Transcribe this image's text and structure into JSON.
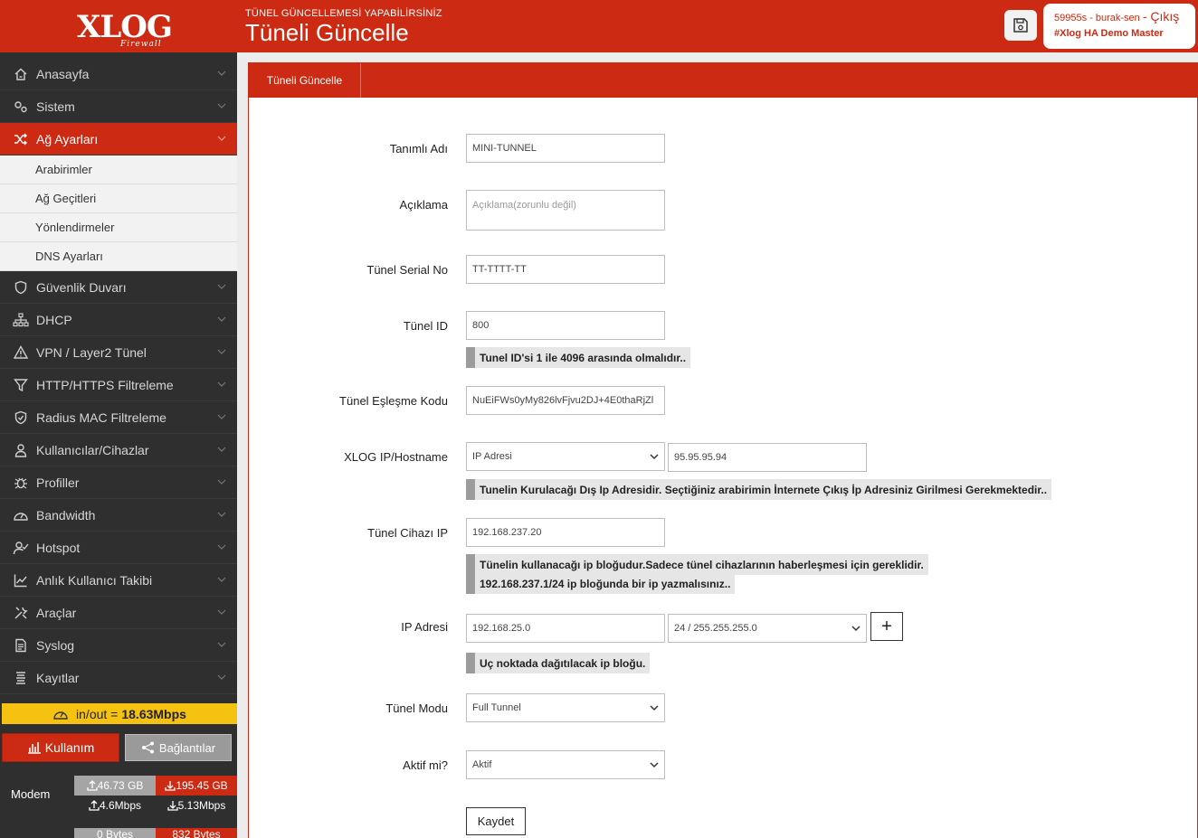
{
  "brand": {
    "logo": "XLOG",
    "logo_sub": "Firewall"
  },
  "sidebar": {
    "items": [
      {
        "label": "Anasayfa",
        "icon": "home-icon"
      },
      {
        "label": "Sistem",
        "icon": "gears-icon"
      },
      {
        "label": "Ağ Ayarları",
        "icon": "shuffle-icon",
        "active": true
      },
      {
        "label": "Güvenlik Duvarı",
        "icon": "shield-icon"
      },
      {
        "label": "DHCP",
        "icon": "sitemap-icon"
      },
      {
        "label": "VPN / Layer2 Tünel",
        "icon": "warning-icon"
      },
      {
        "label": "HTTP/HTTPS Filtreleme",
        "icon": "filter-icon"
      },
      {
        "label": "Radius MAC Filtreleme",
        "icon": "shield-check-icon"
      },
      {
        "label": "Kullanıcılar/Cihazlar",
        "icon": "user-icon"
      },
      {
        "label": "Profiller",
        "icon": "bug-icon"
      },
      {
        "label": "Bandwidth",
        "icon": "gauge-icon"
      },
      {
        "label": "Hotspot",
        "icon": "user-check-icon"
      },
      {
        "label": "Anlık Kullanıcı Takibi",
        "icon": "chart-line-icon"
      },
      {
        "label": "Araçlar",
        "icon": "tools-icon"
      },
      {
        "label": "Syslog",
        "icon": "file-icon"
      },
      {
        "label": "Kayıtlar",
        "icon": "list-icon"
      }
    ],
    "submenu": [
      "Arabirimler",
      "Ağ Geçitleri",
      "Yönlendirmeler",
      "DNS Ayarları"
    ],
    "traffic_label": "in/out =",
    "traffic_value": "18.63Mbps",
    "usage_button": "Kullanım",
    "connections_button": "Bağlantılar",
    "modem": {
      "label": "Modem",
      "upload_total": "46.73 GB",
      "download_total": "195.45 GB",
      "upload_rate": "4.6Mbps",
      "download_rate": "5.13Mbps"
    },
    "modem2": {
      "upload_total": "0 Bytes",
      "download_total": "832 Bytes"
    }
  },
  "header": {
    "subtitle": "TÜNEL GÜNCELLEMESİ YAPABİLİRSİNİZ",
    "title": "Tüneli Güncelle",
    "user_line": "59955s - burak-sen",
    "logout": "- Çıkış",
    "device": "#Xlog HA Demo Master"
  },
  "panel": {
    "tab": "Tüneli Güncelle"
  },
  "form": {
    "name_label": "Tanımlı Adı",
    "name_value": "MINI-TUNNEL",
    "desc_label": "Açıklama",
    "desc_placeholder": "Açıklama(zorunlu değil)",
    "serial_label": "Tünel Serial No",
    "serial_value": "TT-TTTT-TT",
    "id_label": "Tünel ID",
    "id_value": "800",
    "id_hint": "Tunel ID'si 1 ile 4096 arasında olmalıdır..",
    "match_label": "Tünel Eşleşme Kodu",
    "match_value": "NuEiFWs0yMy826lvFjvu2DJ+4E0thaRjZl",
    "host_label": "XLOG IP/Hostname",
    "host_type": "IP Adresi",
    "host_value": "95.95.95.94",
    "host_hint": "Tunelin Kurulacağı Dış Ip Adresidir. Seçtiğiniz arabirimin İnternete Çıkış İp Adresiniz Girilmesi Gerekmektedir..",
    "device_ip_label": "Tünel Cihazı IP",
    "device_ip_value": "192.168.237.20",
    "device_ip_hint1": "Tünelin kullanacağı ip bloğudur.Sadece tünel cihazlarının haberleşmesi için gereklidir.",
    "device_ip_hint2": "192.168.237.1/24 ip bloğunda bir ip yazmalısınız..",
    "ip_label": "IP Adresi",
    "ip_value": "192.168.25.0",
    "ip_mask": "24 / 255.255.255.0",
    "ip_add": "+",
    "ip_hint": "Uç noktada dağıtılacak ip bloğu.",
    "mode_label": "Tünel Modu",
    "mode_value": "Full Tunnel",
    "active_label": "Aktif mi?",
    "active_value": "Aktif",
    "save_label": "Kaydet"
  }
}
